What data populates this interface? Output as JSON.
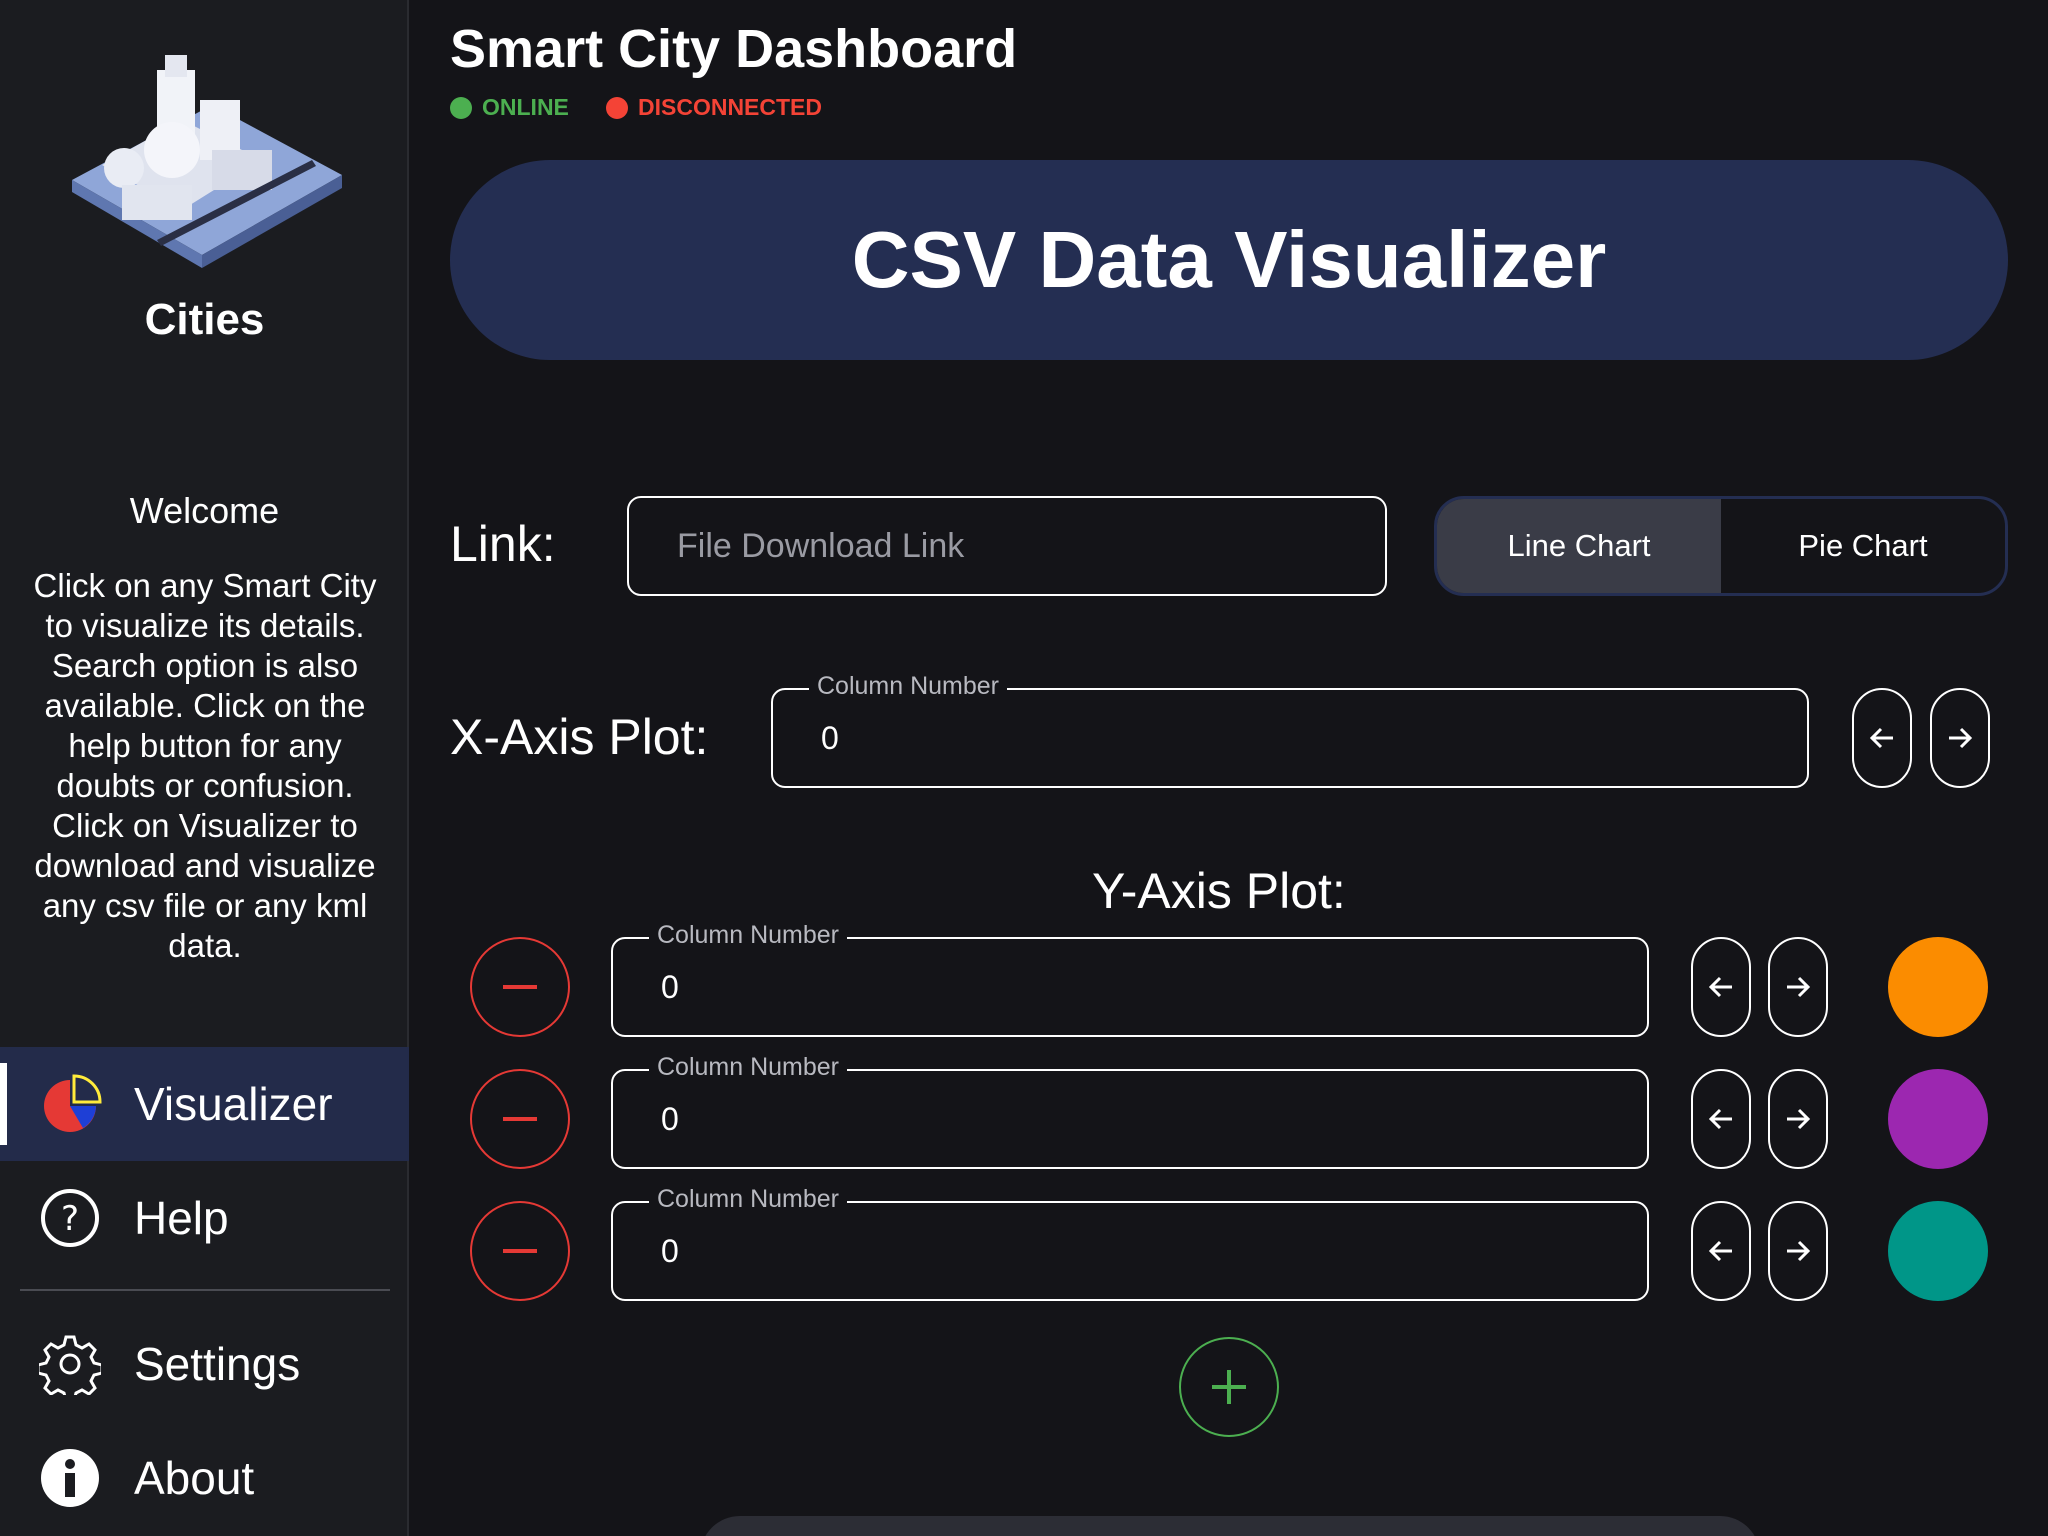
{
  "app": {
    "title": "Smart City Dashboard",
    "status_online": "ONLINE",
    "status_disconnected": "DISCONNECTED"
  },
  "colors": {
    "online": "#4caf50",
    "disconnected": "#f44336",
    "banner": "#242e52",
    "add_button": "#4caf50",
    "remove_button": "#e53935"
  },
  "sidebar": {
    "title": "Cities",
    "welcome_title": "Welcome",
    "welcome_text": "Click on any Smart City to visualize its details. Search option is also available. Click on the help button for any doubts or confusion. Click on Visualizer to download and visualize any csv file or any kml data.",
    "nav": [
      {
        "label": "Visualizer",
        "icon": "pie-chart-icon",
        "active": true
      },
      {
        "label": "Help",
        "icon": "help-circle-icon",
        "active": false
      },
      {
        "label": "Settings",
        "icon": "gear-icon",
        "active": false
      },
      {
        "label": "About",
        "icon": "info-icon",
        "active": false
      }
    ]
  },
  "main": {
    "banner_title": "CSV Data Visualizer",
    "link_label": "Link:",
    "link_placeholder": "File Download Link",
    "link_value": "",
    "chart_types": [
      "Line Chart",
      "Pie Chart"
    ],
    "selected_chart_type": "Line Chart",
    "x_axis": {
      "label": "X-Axis Plot:",
      "field_label": "Column Number",
      "value": "0"
    },
    "y_axis": {
      "label": "Y-Axis Plot:",
      "rows": [
        {
          "field_label": "Column Number",
          "value": "0",
          "color": "#fb8c00"
        },
        {
          "field_label": "Column Number",
          "value": "0",
          "color": "#9c27b0"
        },
        {
          "field_label": "Column Number",
          "value": "0",
          "color": "#009688"
        }
      ]
    }
  }
}
